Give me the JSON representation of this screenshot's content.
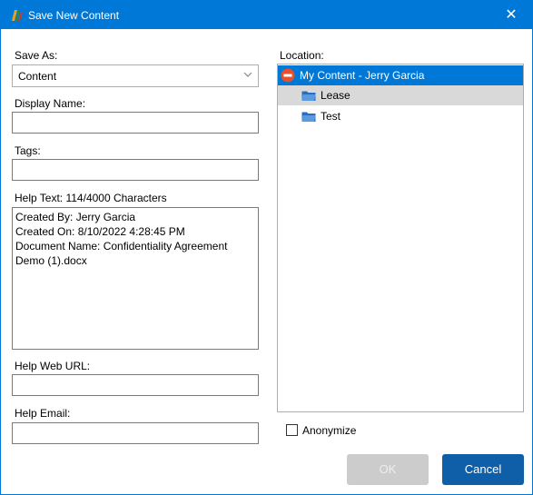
{
  "window": {
    "title": "Save New Content",
    "accent_color": "#0078d7"
  },
  "form": {
    "save_as_label": "Save As:",
    "save_as_value": "Content",
    "display_name_label": "Display Name:",
    "display_name_value": "",
    "tags_label": "Tags:",
    "tags_value": "",
    "help_text_label": "Help Text: 114/4000 Characters",
    "help_text_lines": [
      "Created By: Jerry Garcia",
      "Created On: 8/10/2022 4:28:45 PM",
      "Document Name: Confidentiality Agreement",
      "Demo (1).docx"
    ],
    "help_web_url_label": "Help Web URL:",
    "help_web_url_value": "",
    "help_email_label": "Help Email:",
    "help_email_value": ""
  },
  "location": {
    "label": "Location:",
    "root": {
      "label": "My Content - Jerry Garcia",
      "icon": "no-entry-icon"
    },
    "folders": [
      {
        "label": "Lease",
        "icon": "folder-icon"
      },
      {
        "label": "Test",
        "icon": "folder-icon"
      }
    ]
  },
  "anonymize": {
    "label": "Anonymize",
    "checked": false
  },
  "buttons": {
    "ok_label": "OK",
    "cancel_label": "Cancel"
  }
}
